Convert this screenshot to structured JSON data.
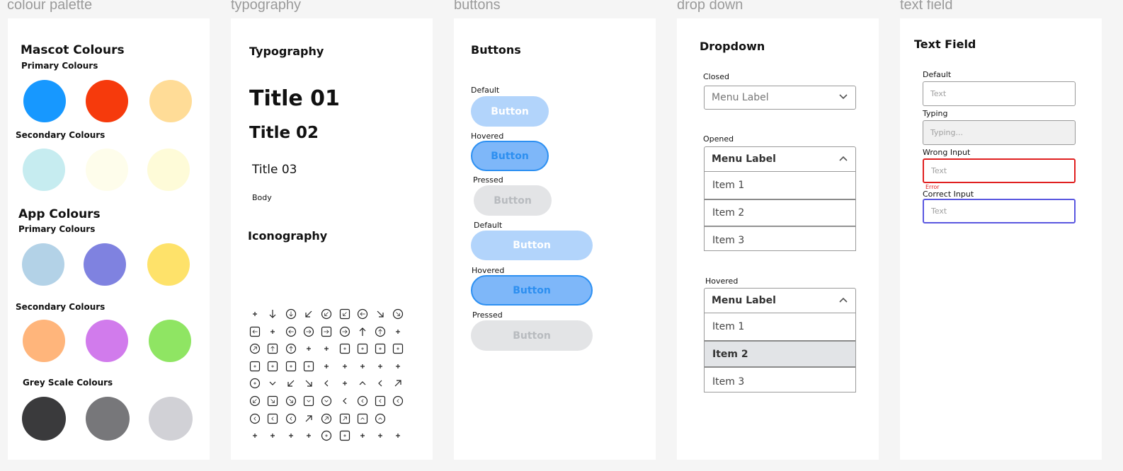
{
  "frame_labels": {
    "palette": "colour palette",
    "typography": "typography",
    "buttons": "buttons",
    "dropdown": "drop down",
    "textfield": "text field"
  },
  "palette": {
    "mascot_title": "Mascot Colours",
    "mascot_primary_label": "Primary Colours",
    "mascot_primary": [
      "#1798FF",
      "#F63A0C",
      "#FFDC97"
    ],
    "mascot_secondary_label": "Secondary Colours",
    "mascot_secondary": [
      "#C6ECF0",
      "#FEFDEB",
      "#FEFBD8"
    ],
    "app_title": "App Colours",
    "app_primary_label": "Primary Colours",
    "app_primary": [
      "#B3D2E7",
      "#7F82E0",
      "#FEE26A"
    ],
    "app_secondary_label": "Secondary Colours",
    "app_secondary": [
      "#FFB57B",
      "#D17BEC",
      "#8FE563"
    ],
    "grey_label": "Grey Scale Colours",
    "grey": [
      "#3A3A3C",
      "#77777A",
      "#D1D1D6"
    ]
  },
  "typography": {
    "title": "Typography",
    "title01": "Title 01",
    "title02": "Title 02",
    "title03": "Title 03",
    "body": "Body",
    "iconography_title": "Iconography",
    "icons": [
      [
        "arrows-exchange-icon",
        "arrow-down-icon",
        "arrow-down-circle-icon",
        "arrow-down-left-icon",
        "arrow-down-left-circle-icon",
        "arrow-down-left-square-icon",
        "arrow-left-circle-icon",
        "arrow-down-right-icon",
        "arrow-down-right-circle-icon"
      ],
      [
        "arrow-left-square-icon",
        "arrows-diagonal-icon",
        "arrow-left-circle-alt-icon",
        "arrow-right-circle-icon",
        "arrow-right-square-icon",
        "arrow-right-circle-alt-icon",
        "arrow-up-icon",
        "arrow-up-circle-icon",
        "arrows-up-down-icon"
      ],
      [
        "arrow-up-right-circle-icon",
        "arrow-up-square-icon",
        "arrow-up-circle-alt-icon",
        "at-icon",
        "bell-icon",
        "bookmark-icon",
        "bookmark-x-icon",
        "bookmark-alt-icon",
        "bookmark-plus-icon"
      ],
      [
        "calendar-plus-icon",
        "calendar-off-icon",
        "calendar-up-icon",
        "calendar-x-icon",
        "campfire-icon",
        "bar-chart-icon",
        "pie-chart-icon",
        "chat-bubble-icon",
        "chat-check-icon"
      ],
      [
        "check-circle-icon",
        "chevrons-down-icon",
        "chevron-corner-down-left-icon",
        "chevron-corner-down-right-icon",
        "chevrons-left-icon",
        "chevrons-right-icon",
        "chevrons-up-icon",
        "chevron-corner-up-left-icon",
        "chevron-corner-up-right-icon"
      ],
      [
        "chevron-circle-down-left-icon",
        "chevron-square-down-right-icon",
        "chevron-circle-down-right-icon",
        "chevron-square-down-icon",
        "chevron-circle-down-icon",
        "chevron-left-icon",
        "chevron-left-circle-icon",
        "chevron-left-square-icon",
        "chevron-left-circle-alt-icon"
      ],
      [
        "chevron-circle-up-left-icon",
        "chevron-square-up-left-icon",
        "chevron-circle-up-left-alt-icon",
        "chevron-corner-up-right-alt-icon",
        "chevron-circle-up-right-icon",
        "chevron-square-up-right-icon",
        "chevron-square-up-icon",
        "chevron-circle-up-icon"
      ],
      [
        "cloud-rain-icon",
        "cloud-off-icon",
        "cloud-upload-icon",
        "code-icon",
        "code-circle-icon",
        "code-square-icon",
        "code-badge-icon",
        "settings-icon",
        "columns-icon"
      ]
    ]
  },
  "buttons": {
    "title": "Buttons",
    "states": [
      {
        "label": "Default",
        "text": "Button"
      },
      {
        "label": "Hovered",
        "text": "Button"
      },
      {
        "label": "Pressed",
        "text": "Button"
      },
      {
        "label": "Default",
        "text": "Button"
      },
      {
        "label": "Hovered",
        "text": "Button"
      },
      {
        "label": "Pressed",
        "text": "Button"
      }
    ]
  },
  "dropdown": {
    "title": "Dropdown",
    "closed_label": "Closed",
    "closed_menu": "Menu Label",
    "opened_label": "Opened",
    "opened_menu": "Menu Label",
    "opened_items": [
      "Item 1",
      "Item 2",
      "Item 3"
    ],
    "hovered_label": "Hovered",
    "hovered_menu": "Menu Label",
    "hovered_items": [
      "Item 1",
      "Item 2",
      "Item 3"
    ]
  },
  "textfield": {
    "title": "Text Field",
    "default_label": "Default",
    "default_placeholder": "Text",
    "typing_label": "Typing",
    "typing_value": "Typing...",
    "wrong_label": "Wrong Input",
    "wrong_placeholder": "Text",
    "error_text": "Error",
    "correct_label": "Correct Input",
    "correct_placeholder": "Text"
  },
  "colors": {
    "button_default": "#B2D4FB",
    "button_hover": "#7EB7F9",
    "button_hover_border": "#2D90F2",
    "button_text_blue": "#2D8FF0",
    "button_text_light": "#FFFFFF",
    "button_pressed": "#E3E4E6",
    "button_pressed_text": "#B8BBBF",
    "error": "#E02020",
    "correct": "#5A57E0"
  }
}
